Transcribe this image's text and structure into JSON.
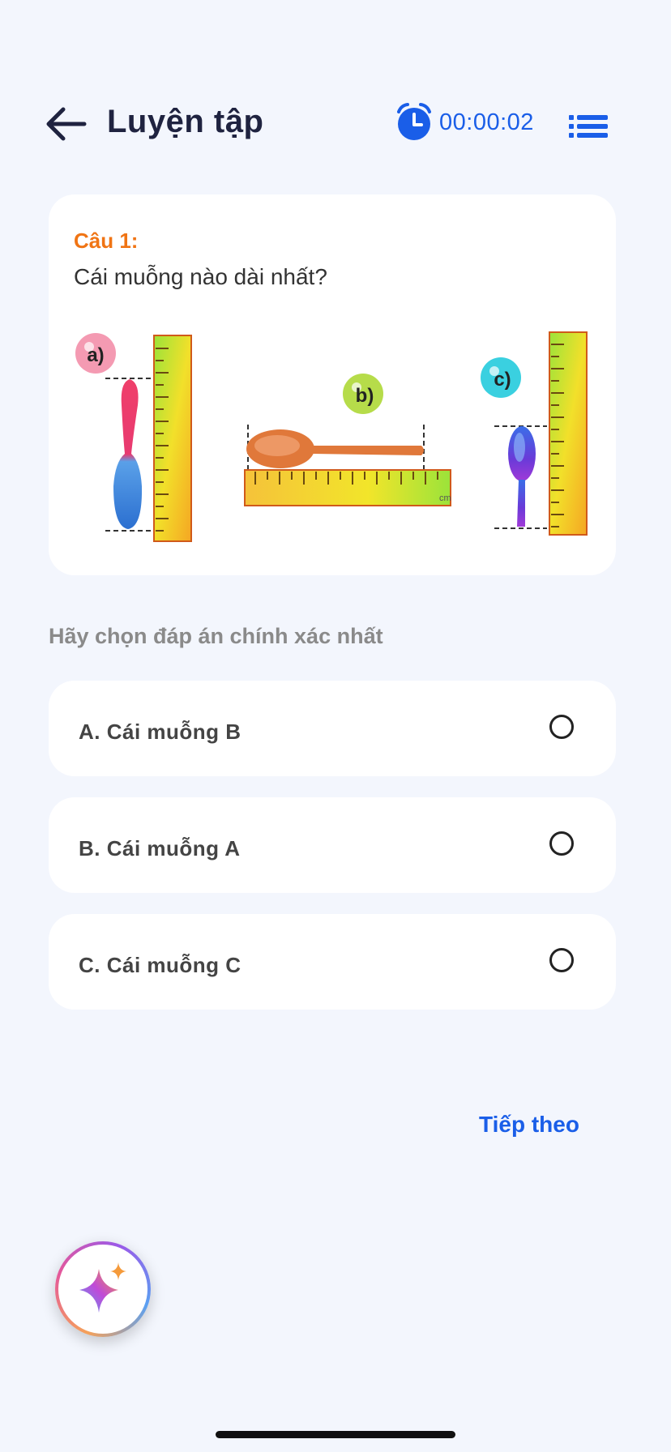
{
  "header": {
    "title": "Luyện tập",
    "timer": "00:00:02"
  },
  "question": {
    "number": "Câu 1:",
    "text": "Cái muỗng nào dài nhất?",
    "illustration": {
      "labels": [
        "a)",
        "b)",
        "c)"
      ],
      "ruler_unit": "cm"
    }
  },
  "hint": "Hãy chọn đáp án chính xác nhất",
  "options": [
    {
      "label": "A. Cái muỗng B"
    },
    {
      "label": "B. Cái muỗng A"
    },
    {
      "label": "C. Cái muỗng C"
    }
  ],
  "next_label": "Tiếp theo",
  "colors": {
    "accent": "#1a5ee8",
    "question_number": "#f07414",
    "background": "#f3f6fd"
  }
}
